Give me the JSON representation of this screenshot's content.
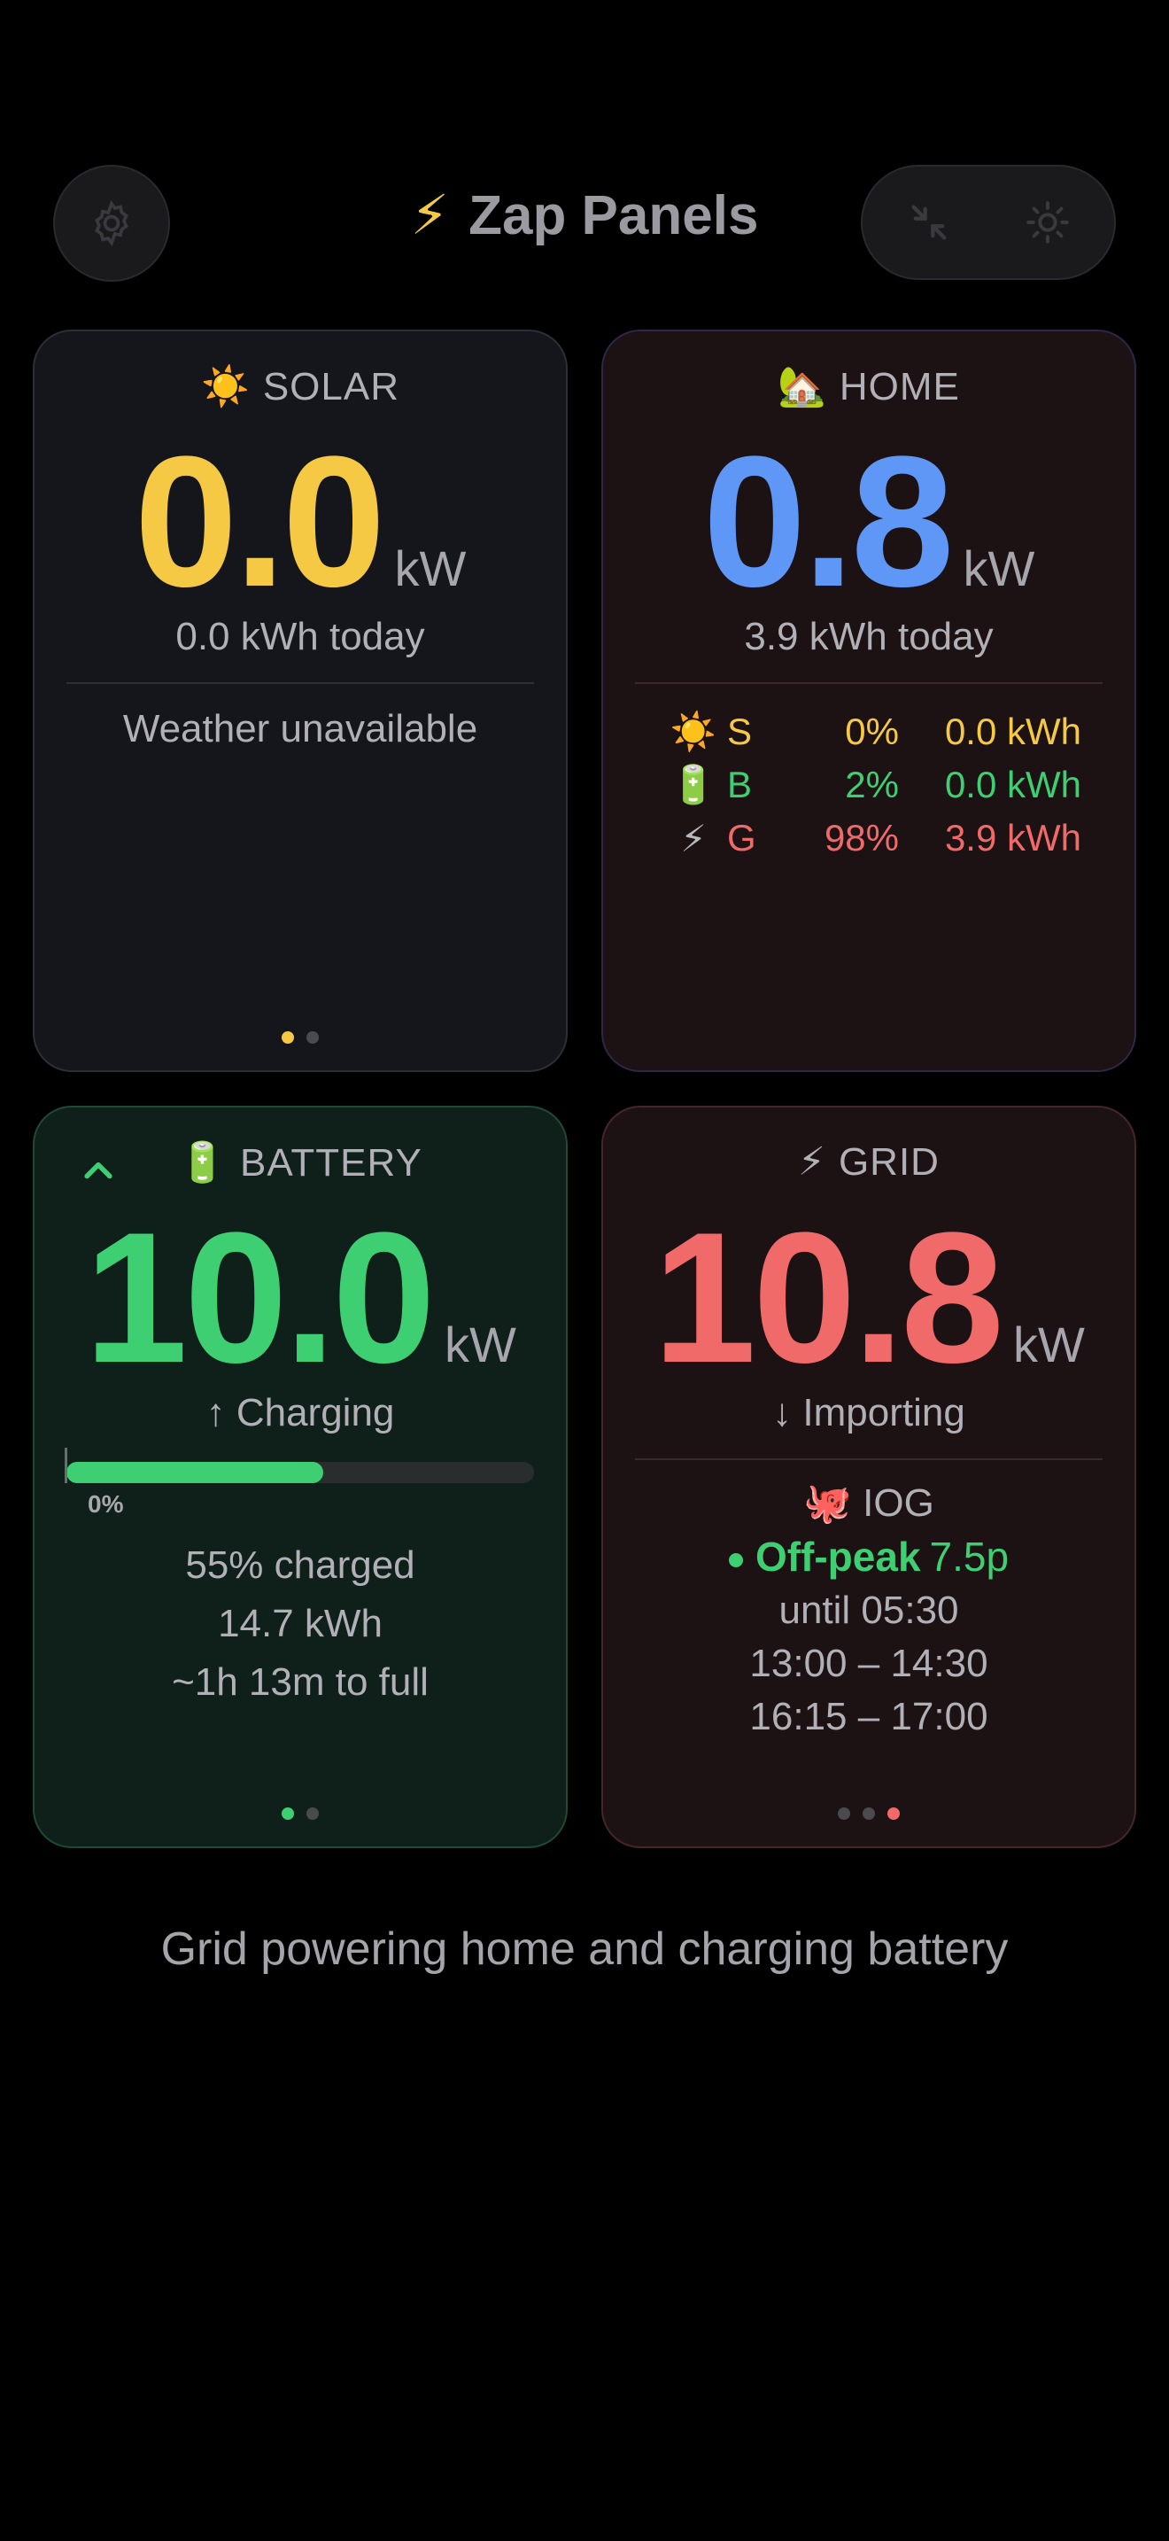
{
  "header": {
    "title_icon": "⚡",
    "title": "Zap Panels",
    "settings_icon": "gear-icon",
    "collapse_icon": "arrows-collapse-icon",
    "theme_icon": "sun-icon"
  },
  "solar": {
    "emoji": "☀️",
    "label": "SOLAR",
    "value": "0.0",
    "unit": "kW",
    "today": "0.0 kWh today",
    "weather": "Weather unavailable",
    "page_count": 2,
    "active_page": 0,
    "color": "#f6c944"
  },
  "home": {
    "emoji": "🏡",
    "label": "HOME",
    "value": "0.8",
    "unit": "kW",
    "today": "3.9 kWh today",
    "color": "#5e97f6",
    "mix": [
      {
        "emoji": "☀️",
        "code": "S",
        "pct": "0%",
        "kwh": "0.0 kWh",
        "color": "#f6c944"
      },
      {
        "emoji": "🔋",
        "code": "B",
        "pct": "2%",
        "kwh": "0.0 kWh",
        "color": "#3ecf73"
      },
      {
        "emoji": "⚡",
        "code": "G",
        "pct": "98%",
        "kwh": "3.9 kWh",
        "color": "#f06a6a"
      }
    ]
  },
  "battery": {
    "emoji": "🔋",
    "label": "BATTERY",
    "value": "10.0",
    "unit": "kW",
    "status": "↑ Charging",
    "charge_fraction": 0.55,
    "bar_start_label": "0%",
    "charged": "55% charged",
    "energy": "14.7 kWh",
    "time_to_full": "~1h 13m to full",
    "page_count": 2,
    "active_page": 0,
    "color": "#3ecf73"
  },
  "grid": {
    "emoji": "⚡",
    "label": "GRID",
    "value": "10.8",
    "unit": "kW",
    "status": "↓ Importing",
    "color": "#f06a6a",
    "tariff_emoji": "🐙",
    "tariff_name": "IOG",
    "period": "Off-peak",
    "price": "7.5p",
    "until": "until 05:30",
    "slots": [
      "13:00 – 14:30",
      "16:15 – 17:00"
    ],
    "page_count": 3,
    "active_page": 2
  },
  "footer": "Grid powering home and charging battery"
}
